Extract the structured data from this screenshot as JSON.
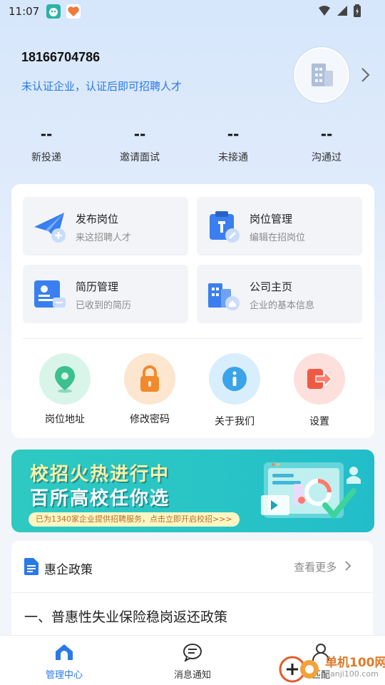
{
  "status_bar": {
    "time": "11:07"
  },
  "profile": {
    "phone": "18166704786",
    "auth_tip": "未认证企业，认证后即可招聘人才"
  },
  "stats": [
    {
      "value": "--",
      "label": "新投递"
    },
    {
      "value": "--",
      "label": "邀请面试"
    },
    {
      "value": "--",
      "label": "未接通"
    },
    {
      "value": "--",
      "label": "沟通过"
    }
  ],
  "functions": [
    {
      "title": "发布岗位",
      "subtitle": "来这招聘人才",
      "icon": "paper-plane-icon"
    },
    {
      "title": "岗位管理",
      "subtitle": "编辑在招岗位",
      "icon": "job-management-icon"
    },
    {
      "title": "简历管理",
      "subtitle": "已收到的简历",
      "icon": "resume-icon"
    },
    {
      "title": "公司主页",
      "subtitle": "企业的基本信息",
      "icon": "company-building-icon"
    }
  ],
  "quick_actions": [
    {
      "label": "岗位地址",
      "icon": "location-pin-icon",
      "bg": "#d9f5ea",
      "color": "#3cc08f"
    },
    {
      "label": "修改密码",
      "icon": "lock-icon",
      "bg": "#fde6cf",
      "color": "#f08a2c"
    },
    {
      "label": "关于我们",
      "icon": "info-icon",
      "bg": "#d9eefc",
      "color": "#3aa3ea"
    },
    {
      "label": "设置",
      "icon": "logout-icon",
      "bg": "#fde0dc",
      "color": "#ef5a44"
    }
  ],
  "banner": {
    "line1": "校招火热进行中",
    "line2": "百所高校任你选",
    "pill": "已为1340家企业提供招聘服务，点击立即开启校招>>>"
  },
  "policy": {
    "title": "惠企政策",
    "more": "查看更多",
    "item": "一、普惠性失业保险稳岗返还政策"
  },
  "bottom_nav": [
    {
      "label": "管理中心",
      "icon": "home-icon",
      "active": true
    },
    {
      "label": "消息通知",
      "icon": "message-icon",
      "active": false
    },
    {
      "label": "匹配",
      "icon": "person-icon",
      "active": false
    }
  ],
  "watermark": {
    "text": "单机100网",
    "sub": "danji100.com"
  },
  "colors": {
    "accent": "#2a79e8",
    "nav_active": "#2a79e8",
    "nav_inactive": "#333333"
  }
}
